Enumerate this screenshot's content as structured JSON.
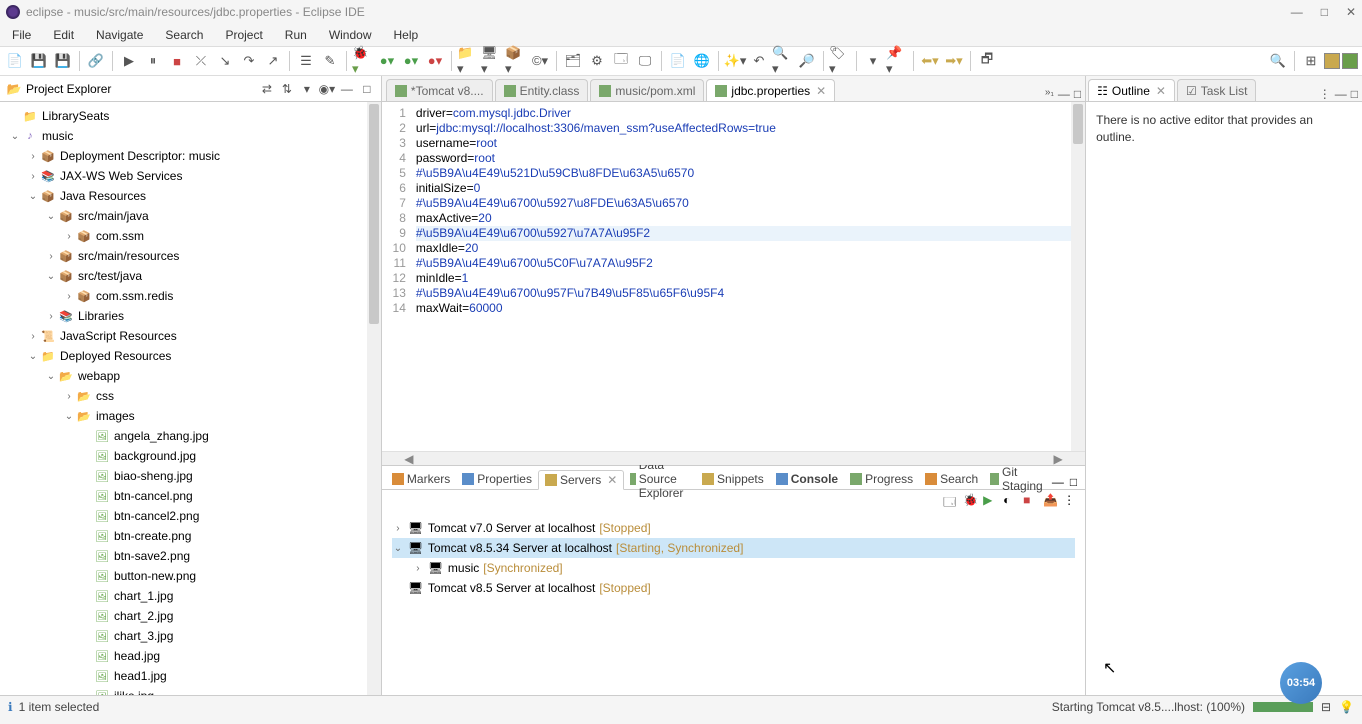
{
  "window": {
    "title": "eclipse - music/src/main/resources/jdbc.properties - Eclipse IDE"
  },
  "menu": [
    "File",
    "Edit",
    "Navigate",
    "Search",
    "Project",
    "Run",
    "Window",
    "Help"
  ],
  "explorer": {
    "title": "Project Explorer",
    "items": [
      {
        "depth": 0,
        "tw": "",
        "icon": "folder-c",
        "label": "LibrarySeats"
      },
      {
        "depth": 0,
        "tw": "v",
        "icon": "juno",
        "label": "music"
      },
      {
        "depth": 1,
        "tw": ">",
        "icon": "pkg",
        "label": "Deployment Descriptor: music"
      },
      {
        "depth": 1,
        "tw": ">",
        "icon": "jar",
        "label": "JAX-WS Web Services"
      },
      {
        "depth": 1,
        "tw": "v",
        "icon": "pkg",
        "label": "Java Resources"
      },
      {
        "depth": 2,
        "tw": "v",
        "icon": "pkg",
        "label": "src/main/java"
      },
      {
        "depth": 3,
        "tw": ">",
        "icon": "pkg",
        "label": "com.ssm"
      },
      {
        "depth": 2,
        "tw": ">",
        "icon": "pkg",
        "label": "src/main/resources"
      },
      {
        "depth": 2,
        "tw": "v",
        "icon": "pkg",
        "label": "src/test/java"
      },
      {
        "depth": 3,
        "tw": ">",
        "icon": "pkg",
        "label": "com.ssm.redis"
      },
      {
        "depth": 2,
        "tw": ">",
        "icon": "jar",
        "label": "Libraries"
      },
      {
        "depth": 1,
        "tw": ">",
        "icon": "js",
        "label": "JavaScript Resources"
      },
      {
        "depth": 1,
        "tw": "v",
        "icon": "folder-c",
        "label": "Deployed Resources"
      },
      {
        "depth": 2,
        "tw": "v",
        "icon": "folder-o",
        "label": "webapp"
      },
      {
        "depth": 3,
        "tw": ">",
        "icon": "folder-o",
        "label": "css"
      },
      {
        "depth": 3,
        "tw": "v",
        "icon": "folder-o",
        "label": "images"
      },
      {
        "depth": 4,
        "tw": "",
        "icon": "img",
        "label": "angela_zhang.jpg"
      },
      {
        "depth": 4,
        "tw": "",
        "icon": "img",
        "label": "background.jpg"
      },
      {
        "depth": 4,
        "tw": "",
        "icon": "img",
        "label": "biao-sheng.jpg"
      },
      {
        "depth": 4,
        "tw": "",
        "icon": "img",
        "label": "btn-cancel.png"
      },
      {
        "depth": 4,
        "tw": "",
        "icon": "img",
        "label": "btn-cancel2.png"
      },
      {
        "depth": 4,
        "tw": "",
        "icon": "img",
        "label": "btn-create.png"
      },
      {
        "depth": 4,
        "tw": "",
        "icon": "img",
        "label": "btn-save2.png"
      },
      {
        "depth": 4,
        "tw": "",
        "icon": "img",
        "label": "button-new.png"
      },
      {
        "depth": 4,
        "tw": "",
        "icon": "img",
        "label": "chart_1.jpg"
      },
      {
        "depth": 4,
        "tw": "",
        "icon": "img",
        "label": "chart_2.jpg"
      },
      {
        "depth": 4,
        "tw": "",
        "icon": "img",
        "label": "chart_3.jpg"
      },
      {
        "depth": 4,
        "tw": "",
        "icon": "img",
        "label": "head.jpg"
      },
      {
        "depth": 4,
        "tw": "",
        "icon": "img",
        "label": "head1.jpg"
      },
      {
        "depth": 4,
        "tw": "",
        "icon": "img",
        "label": "ilike.jpg"
      }
    ]
  },
  "editorTabs": [
    {
      "label": "*Tomcat v8....",
      "active": false
    },
    {
      "label": "Entity.class",
      "active": false
    },
    {
      "label": "music/pom.xml",
      "active": false
    },
    {
      "label": "jdbc.properties",
      "active": true
    }
  ],
  "code": [
    {
      "n": "1",
      "t": "driver=",
      "v": "com.mysql.jdbc.Driver"
    },
    {
      "n": "2",
      "t": "url=",
      "v": "jdbc:mysql://localhost:3306/maven_ssm?useAffectedRows=true"
    },
    {
      "n": "3",
      "t": "username=",
      "v": "root"
    },
    {
      "n": "4",
      "t": "password=",
      "v": "root"
    },
    {
      "n": "5",
      "t": "",
      "v": "#\\u5B9A\\u4E49\\u521D\\u59CB\\u8FDE\\u63A5\\u6570"
    },
    {
      "n": "6",
      "t": "initialSize=",
      "v": "0"
    },
    {
      "n": "7",
      "t": "",
      "v": "#\\u5B9A\\u4E49\\u6700\\u5927\\u8FDE\\u63A5\\u6570"
    },
    {
      "n": "8",
      "t": "maxActive=",
      "v": "20"
    },
    {
      "n": "9",
      "t": "",
      "v": "#\\u5B9A\\u4E49\\u6700\\u5927\\u7A7A\\u95F2",
      "hl": true
    },
    {
      "n": "10",
      "t": "maxIdle=",
      "v": "20"
    },
    {
      "n": "11",
      "t": "",
      "v": "#\\u5B9A\\u4E49\\u6700\\u5C0F\\u7A7A\\u95F2"
    },
    {
      "n": "12",
      "t": "minIdle=",
      "v": "1"
    },
    {
      "n": "13",
      "t": "",
      "v": "#\\u5B9A\\u4E49\\u6700\\u957F\\u7B49\\u5F85\\u65F6\\u95F4"
    },
    {
      "n": "14",
      "t": "maxWait=",
      "v": "60000"
    }
  ],
  "bottomTabs": [
    {
      "label": "Markers",
      "icon": "#d98c3a"
    },
    {
      "label": "Properties",
      "icon": "#5a8dc9"
    },
    {
      "label": "Servers",
      "icon": "#c9a94f",
      "active": true
    },
    {
      "label": "Data Source Explorer",
      "icon": "#7aa86b"
    },
    {
      "label": "Snippets",
      "icon": "#c9a94f"
    },
    {
      "label": "Console",
      "icon": "#5a8dc9",
      "bold": true
    },
    {
      "label": "Progress",
      "icon": "#7aa86b"
    },
    {
      "label": "Search",
      "icon": "#d98c3a"
    },
    {
      "label": "Git Staging",
      "icon": "#7aa86b"
    }
  ],
  "servers": [
    {
      "depth": 0,
      "tw": ">",
      "label": "Tomcat v7.0 Server at localhost",
      "status": "[Stopped]",
      "cls": "status-stopped"
    },
    {
      "depth": 0,
      "tw": "v",
      "label": "Tomcat v8.5.34 Server at localhost",
      "status": "[Starting, Synchronized]",
      "cls": "status-starting",
      "sel": true
    },
    {
      "depth": 1,
      "tw": ">",
      "label": "music",
      "status": "[Synchronized]",
      "cls": "status-sync"
    },
    {
      "depth": 0,
      "tw": "",
      "label": "Tomcat v8.5 Server at localhost",
      "status": "[Stopped]",
      "cls": "status-stopped"
    }
  ],
  "outline": {
    "tab1": "Outline",
    "tab2": "Task List",
    "body": "There is no active editor that provides an outline."
  },
  "status": {
    "left": "1 item selected",
    "right": "Starting Tomcat v8.5....lhost: (100%)"
  },
  "timer": "03:54"
}
